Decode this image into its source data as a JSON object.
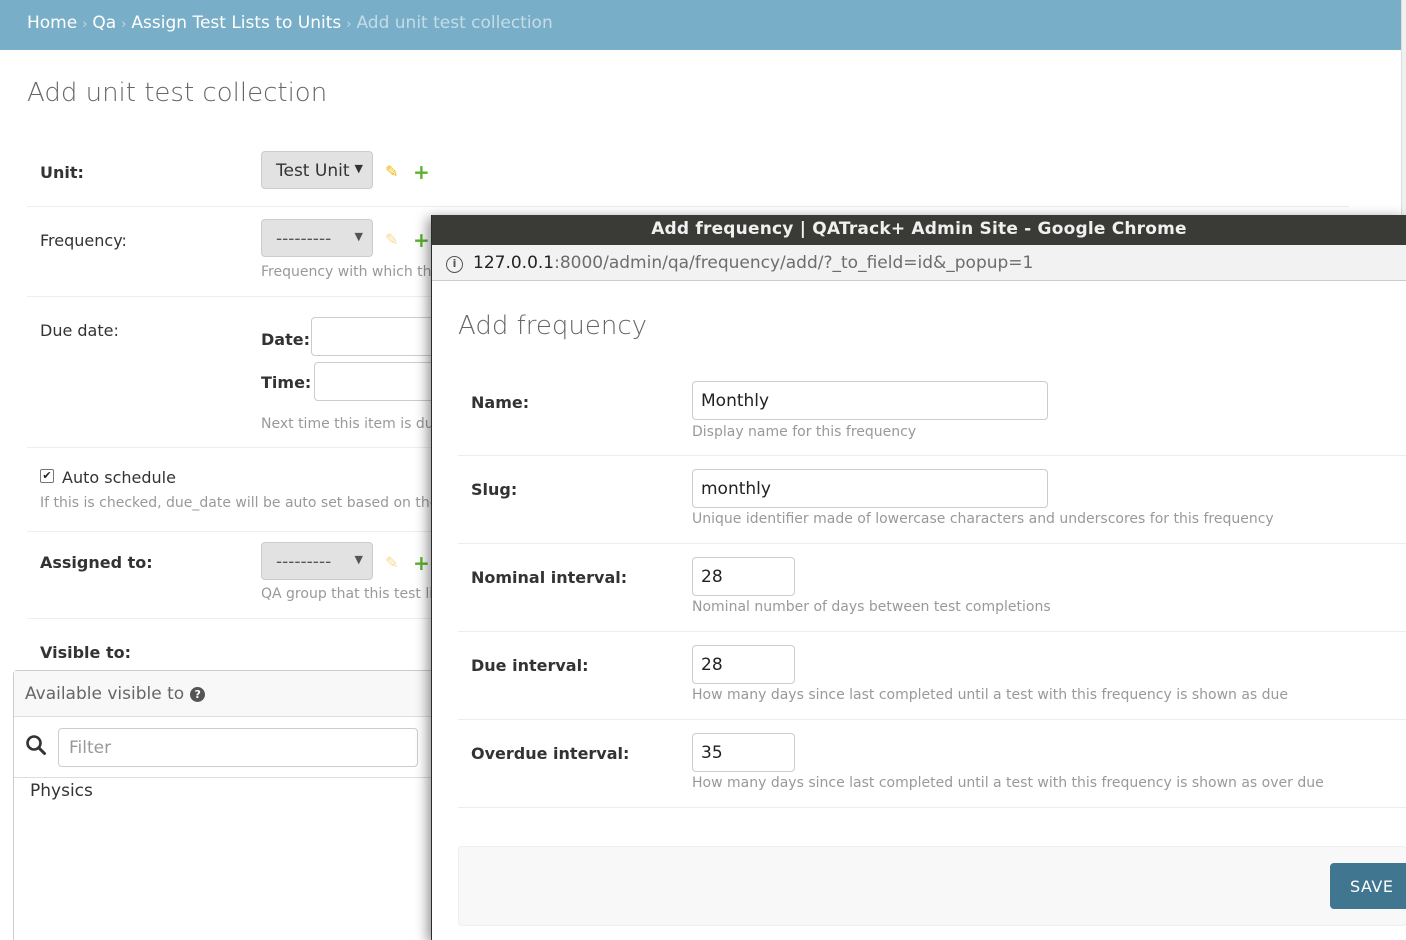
{
  "breadcrumbs": {
    "home": "Home",
    "qa": "Qa",
    "section": "Assign Test Lists to Units",
    "current": "Add unit test collection",
    "separator": "›"
  },
  "page": {
    "title": "Add unit test collection"
  },
  "unit": {
    "label": "Unit:",
    "value": "Test Unit"
  },
  "frequency": {
    "label": "Frequency:",
    "value": "---------",
    "help": "Frequency with which this"
  },
  "due_date": {
    "label": "Due date:",
    "date_label": "Date:",
    "time_label": "Time:",
    "help": "Next time this item is due"
  },
  "auto_schedule": {
    "label": "Auto schedule",
    "checked": true,
    "help": "If this is checked, due_date will be auto set based on the assi"
  },
  "assigned_to": {
    "label": "Assigned to:",
    "value": "---------",
    "help": "QA group that this test list"
  },
  "visible_to": {
    "label": "Visible to:",
    "available_title": "Available visible to",
    "filter_placeholder": "Filter",
    "options": [
      "Physics"
    ]
  },
  "popup": {
    "window_title": "Add frequency | QATrack+ Admin Site - Google Chrome",
    "url_host": "127.0.0.1",
    "url_rest": ":8000/admin/qa/frequency/add/?_to_field=id&_popup=1",
    "title": "Add frequency",
    "fields": {
      "name": {
        "label": "Name:",
        "value": "Monthly",
        "help": "Display name for this frequency"
      },
      "slug": {
        "label": "Slug:",
        "value": "monthly",
        "help": "Unique identifier made of lowercase characters and underscores for this frequency"
      },
      "nominal_interval": {
        "label": "Nominal interval:",
        "value": "28",
        "help": "Nominal number of days between test completions"
      },
      "due_interval": {
        "label": "Due interval:",
        "value": "28",
        "help": "How many days since last completed until a test with this frequency is shown as due"
      },
      "overdue_interval": {
        "label": "Overdue interval:",
        "value": "35",
        "help": "How many days since last completed until a test with this frequency is shown as over due"
      }
    },
    "save_label": "SAVE"
  }
}
